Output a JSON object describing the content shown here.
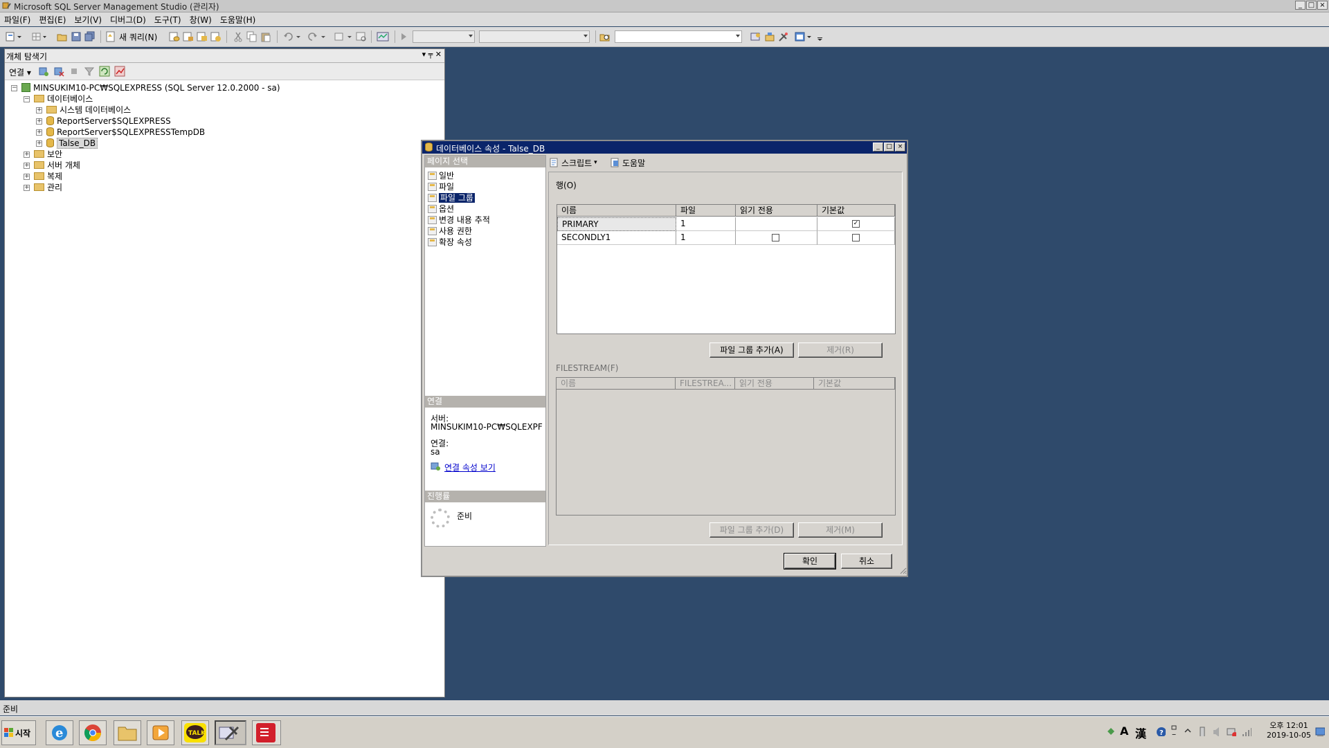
{
  "app": {
    "title": "Microsoft SQL Server Management Studio (관리자)",
    "window_buttons": [
      "_",
      "□",
      "×"
    ]
  },
  "menu": [
    "파일(F)",
    "편집(E)",
    "보기(V)",
    "디버그(D)",
    "도구(T)",
    "창(W)",
    "도움말(H)"
  ],
  "toolbar": {
    "new_query_label": "새 쿼리(N)"
  },
  "object_explorer": {
    "title": "개체 탐색기",
    "pin_icon": "▾ ╤ ✕",
    "connect_label": "연결",
    "server_node": "MINSUKIM10-PC₩SQLEXPRESS (SQL Server 12.0.2000 - sa)",
    "databases_node": "데이터베이스",
    "system_db_node": "시스템 데이터베이스",
    "db_items": [
      "ReportServer$SQLEXPRESS",
      "ReportServer$SQLEXPRESSTempDB",
      "Talse_DB"
    ],
    "top_nodes": [
      "보안",
      "서버 개체",
      "복제",
      "관리"
    ]
  },
  "status_bar": {
    "text": "준비"
  },
  "dialog": {
    "title": "데이터베이스 속성 - Talse_DB",
    "page_select_header": "페이지 선택",
    "pages": [
      "일반",
      "파일",
      "파일 그룹",
      "옵션",
      "변경 내용 추적",
      "사용 권한",
      "확장 속성"
    ],
    "selected_page": "파일 그룹",
    "connection_header": "연결",
    "server_label": "서버:",
    "server_value": "MINSUKIM10-PC₩SQLEXPF",
    "connection_label": "연결:",
    "connection_value": "sa",
    "view_connection_link": "연결 속성 보기",
    "progress_header": "진행률",
    "progress_status": "준비",
    "script_label": "스크립트",
    "help_label": "도움말",
    "rows_label": "행(O)",
    "rows_grid": {
      "headers": [
        "이름",
        "파일",
        "읽기 전용",
        "기본값"
      ],
      "rows": [
        {
          "name": "PRIMARY",
          "files": "1",
          "read_only": null,
          "default": true
        },
        {
          "name": "SECONDLY1",
          "files": "1",
          "read_only": false,
          "default": false
        }
      ]
    },
    "add_filegroup_button": "파일 그룹 추가(A)",
    "remove_button": "제거(R)",
    "filestream_label": "FILESTREAM(F)",
    "filestream_grid": {
      "headers": [
        "이름",
        "FILESTREA...",
        "읽기 전용",
        "기본값"
      ]
    },
    "add_filestream_button": "파일 그룹 추가(D)",
    "remove_filestream_button": "제거(M)",
    "ok_button": "확인",
    "cancel_button": "취소"
  },
  "taskbar": {
    "start_label": "시작",
    "talk_label": "TALK",
    "ime": [
      "A",
      "漢"
    ],
    "clock_time": "오후 12:01",
    "clock_date": "2019-10-05"
  }
}
